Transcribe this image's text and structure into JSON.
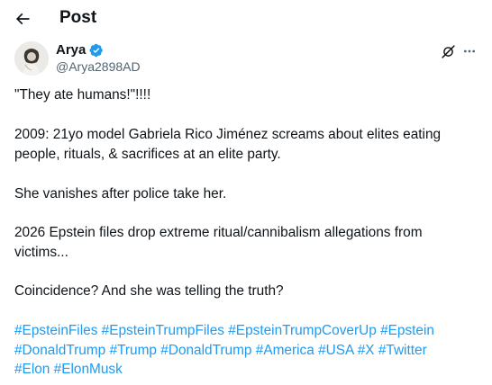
{
  "header": {
    "title": "Post",
    "back_icon": "arrow-left-icon"
  },
  "author": {
    "display_name": "Arya",
    "handle": "@Arya2898AD",
    "verified_color": "#1d9bf0",
    "grok_icon": "grok-icon",
    "more_icon": "more-horizontal-icon"
  },
  "post": {
    "line1": "\"They ate humans!\"!!!!",
    "line2a": "2009: 21yo model Gabriela Rico Jiménez screams about elites eating",
    "line2b": "people, rituals, & sacrifices at an elite party.",
    "line3": "She vanishes after police take her.",
    "line4a": "2026 Epstein files drop extreme ritual/cannibalism allegations from",
    "line4b": "victims...",
    "line5": "Coincidence? And she was telling the truth?"
  },
  "hashtags": {
    "h0": "#EpsteinFiles",
    "h1": "#EpsteinTrumpFiles",
    "h2": "#EpsteinTrumpCoverUp",
    "h3": "#Epstein",
    "h4": "#DonaldTrump",
    "h5": "#Trump",
    "h6": "#DonaldTrump",
    "h7": "#America",
    "h8": "#USA",
    "h9": "#X",
    "h10": "#Twitter",
    "h11": "#Elon",
    "h12": "#ElonMusk"
  },
  "colors": {
    "link": "#1d9bf0",
    "text": "#0f1419",
    "muted": "#536471"
  }
}
